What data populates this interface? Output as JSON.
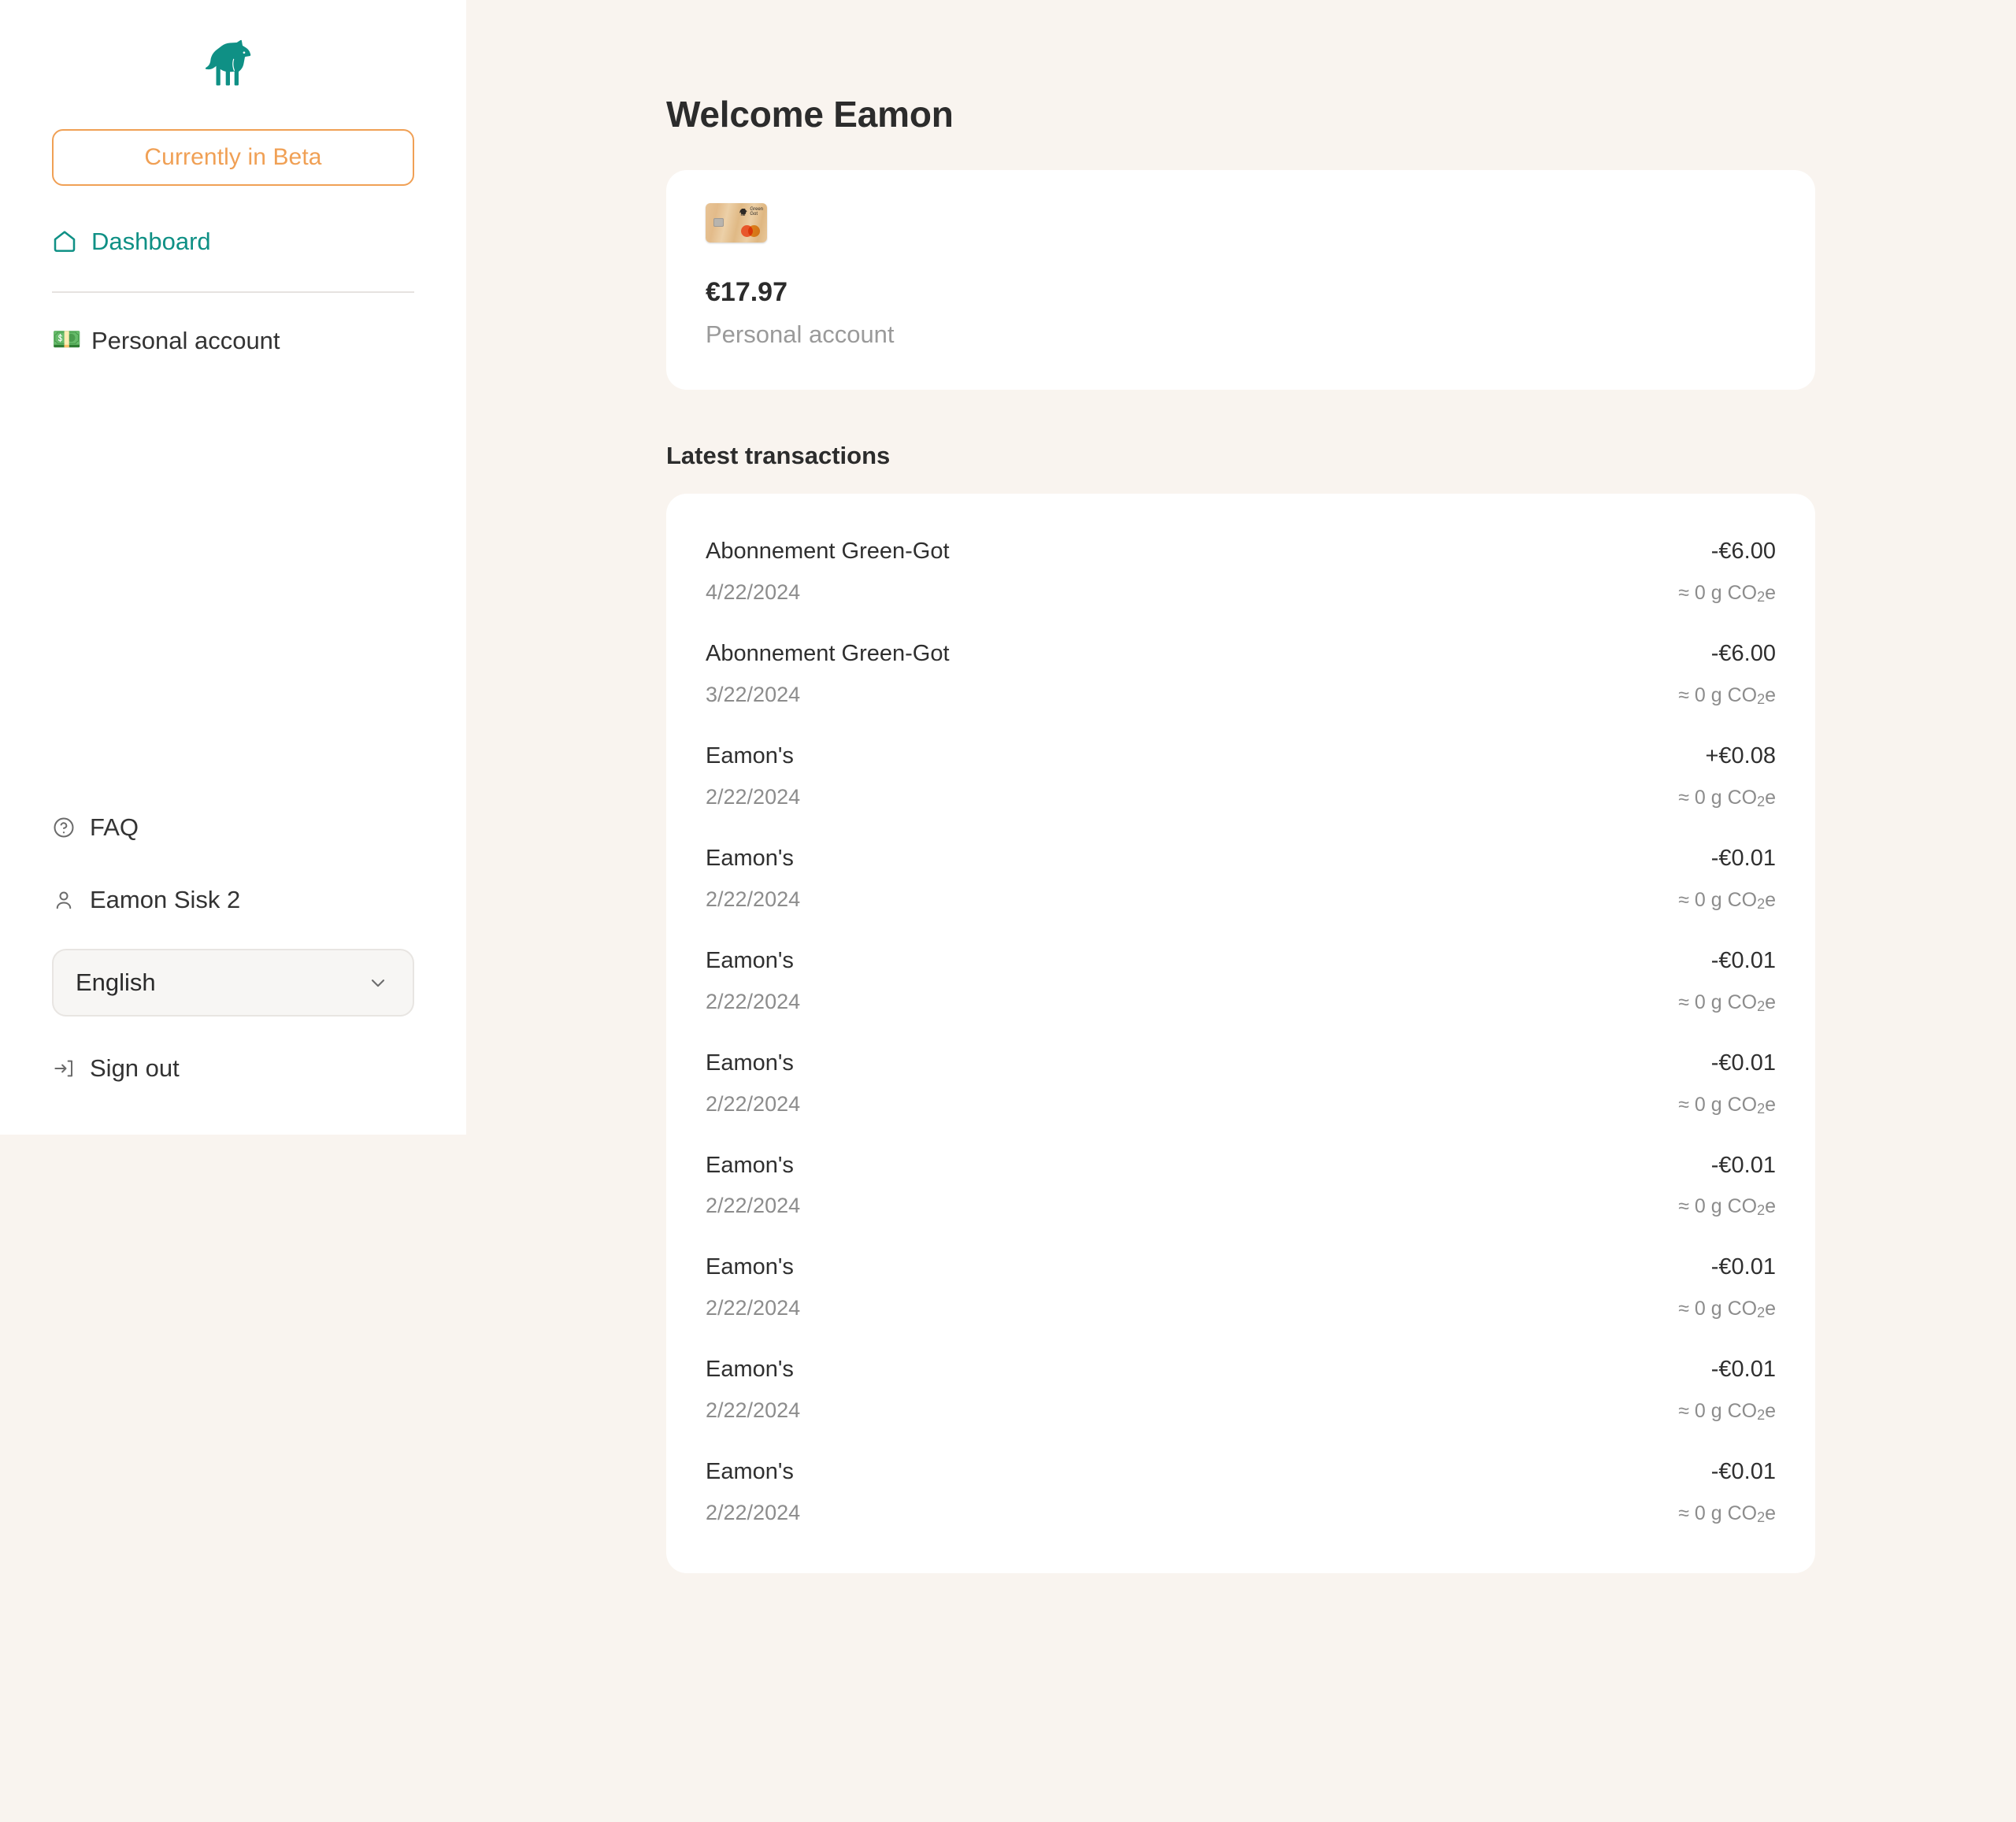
{
  "brand": {
    "logo_icon": "fox-logo-icon",
    "accent_teal": "#0f9085",
    "accent_orange": "#f0a055",
    "page_background": "#f9f4ef"
  },
  "sidebar": {
    "beta_label": "Currently in Beta",
    "nav": [
      {
        "label": "Dashboard",
        "icon": "home-icon",
        "active": true
      },
      {
        "label": "Personal account",
        "icon": "euro-banknote-icon",
        "active": false
      }
    ],
    "utilities": {
      "faq_label": "FAQ",
      "faq_icon": "question-circle-icon",
      "user_label": "Eamon Sisk 2",
      "user_icon": "person-icon",
      "signout_label": "Sign out",
      "signout_icon": "sign-out-icon"
    },
    "language": {
      "selected": "English",
      "chevron_icon": "chevron-down-icon",
      "options": [
        "English"
      ]
    }
  },
  "main": {
    "page_title": "Welcome Eamon",
    "balance_card": {
      "card_image_alt": "green-got-wooden-mastercard",
      "card_brand_line1": "Green",
      "card_brand_line2": "Got",
      "amount": "€17.97",
      "account_name": "Personal account"
    },
    "transactions_title": "Latest transactions",
    "transactions": [
      {
        "name": "Abonnement Green-Got",
        "date": "4/22/2024",
        "amount": "-€6.00",
        "co2": "≈ 0 g CO",
        "co2_sub": "2",
        "co2_suffix": "e"
      },
      {
        "name": "Abonnement Green-Got",
        "date": "3/22/2024",
        "amount": "-€6.00",
        "co2": "≈ 0 g CO",
        "co2_sub": "2",
        "co2_suffix": "e"
      },
      {
        "name": "Eamon's",
        "date": "2/22/2024",
        "amount": "+€0.08",
        "co2": "≈ 0 g CO",
        "co2_sub": "2",
        "co2_suffix": "e"
      },
      {
        "name": "Eamon's",
        "date": "2/22/2024",
        "amount": "-€0.01",
        "co2": "≈ 0 g CO",
        "co2_sub": "2",
        "co2_suffix": "e"
      },
      {
        "name": "Eamon's",
        "date": "2/22/2024",
        "amount": "-€0.01",
        "co2": "≈ 0 g CO",
        "co2_sub": "2",
        "co2_suffix": "e"
      },
      {
        "name": "Eamon's",
        "date": "2/22/2024",
        "amount": "-€0.01",
        "co2": "≈ 0 g CO",
        "co2_sub": "2",
        "co2_suffix": "e"
      },
      {
        "name": "Eamon's",
        "date": "2/22/2024",
        "amount": "-€0.01",
        "co2": "≈ 0 g CO",
        "co2_sub": "2",
        "co2_suffix": "e"
      },
      {
        "name": "Eamon's",
        "date": "2/22/2024",
        "amount": "-€0.01",
        "co2": "≈ 0 g CO",
        "co2_sub": "2",
        "co2_suffix": "e"
      },
      {
        "name": "Eamon's",
        "date": "2/22/2024",
        "amount": "-€0.01",
        "co2": "≈ 0 g CO",
        "co2_sub": "2",
        "co2_suffix": "e"
      },
      {
        "name": "Eamon's",
        "date": "2/22/2024",
        "amount": "-€0.01",
        "co2": "≈ 0 g CO",
        "co2_sub": "2",
        "co2_suffix": "e"
      }
    ]
  }
}
